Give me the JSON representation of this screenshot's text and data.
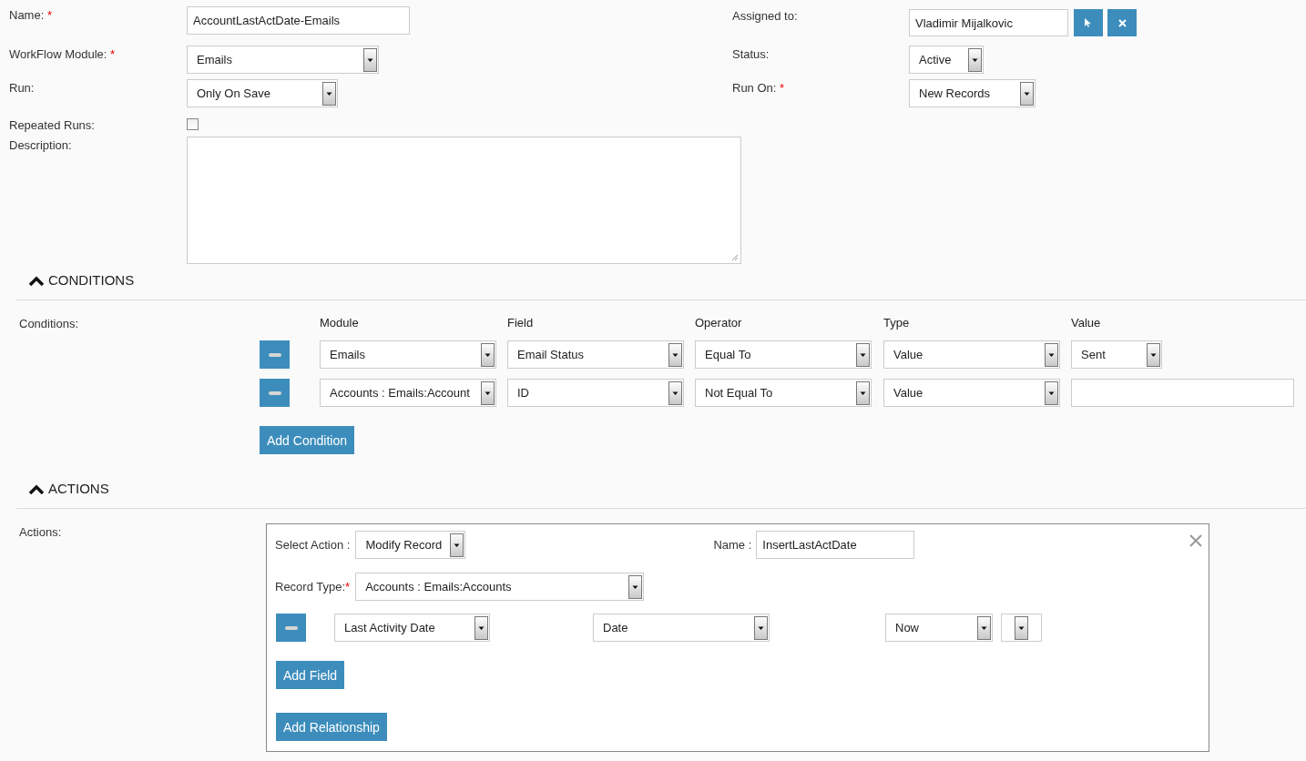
{
  "form": {
    "fields": [
      {
        "label": "Name:",
        "required_mark": "*",
        "kind": "text",
        "value": "AccountLastActDate-Emails"
      },
      {
        "label": "WorkFlow Module:",
        "required_mark": "*",
        "kind": "select",
        "value": "Emails"
      },
      {
        "label": "Run:",
        "kind": "select",
        "value": "Only On Save"
      },
      {
        "label": "Repeated Runs:",
        "kind": "checkbox",
        "checked": false
      },
      {
        "label": "Description:",
        "kind": "textarea"
      }
    ],
    "side_fields": [
      {
        "label": "Assigned to:",
        "kind": "relate",
        "value": "Vladimir Mijalkovic"
      },
      {
        "label": "Status:",
        "kind": "select",
        "value": "Active"
      },
      {
        "label": "Run On:",
        "required_mark": "*",
        "kind": "select",
        "value": "New Records"
      }
    ]
  },
  "conditions": {
    "title": "CONDITIONS",
    "expanded": true,
    "label": "Conditions:",
    "columns": [
      "Module",
      "Field",
      "Operator",
      "Type",
      "Value"
    ],
    "rows": [
      {
        "cells": [
          {
            "kind": "select",
            "value": "Emails"
          },
          {
            "kind": "select",
            "value": "Email Status"
          },
          {
            "kind": "select",
            "value": "Equal To"
          },
          {
            "kind": "select",
            "value": "Value"
          },
          {
            "kind": "select",
            "value": "Sent"
          }
        ]
      },
      {
        "cells": [
          {
            "kind": "select",
            "value": "Accounts : Emails:Account"
          },
          {
            "kind": "select",
            "value": "ID"
          },
          {
            "kind": "select",
            "value": "Not Equal To"
          },
          {
            "kind": "select",
            "value": "Value"
          },
          {
            "kind": "text"
          }
        ]
      }
    ],
    "add_button": "Add Condition"
  },
  "actions": {
    "title": "ACTIONS",
    "expanded": true,
    "label": "Actions:",
    "action": {
      "select_label": "Select Action :",
      "select_value": "Modify Record",
      "name_label": "Name :",
      "name_value": "InsertLastActDate",
      "record_type_label": "Record Type:",
      "record_type_required_mark": "*",
      "record_type_value": "Accounts : Emails:Accounts",
      "fields": [
        {
          "cells": [
            {
              "kind": "select",
              "value": "Last Activity Date"
            },
            {
              "kind": "select",
              "value": "Date"
            },
            {
              "kind": "select",
              "value": "Now"
            },
            {
              "kind": "select"
            }
          ]
        }
      ],
      "add_field": "Add Field",
      "add_relationship": "Add Relationship"
    }
  }
}
